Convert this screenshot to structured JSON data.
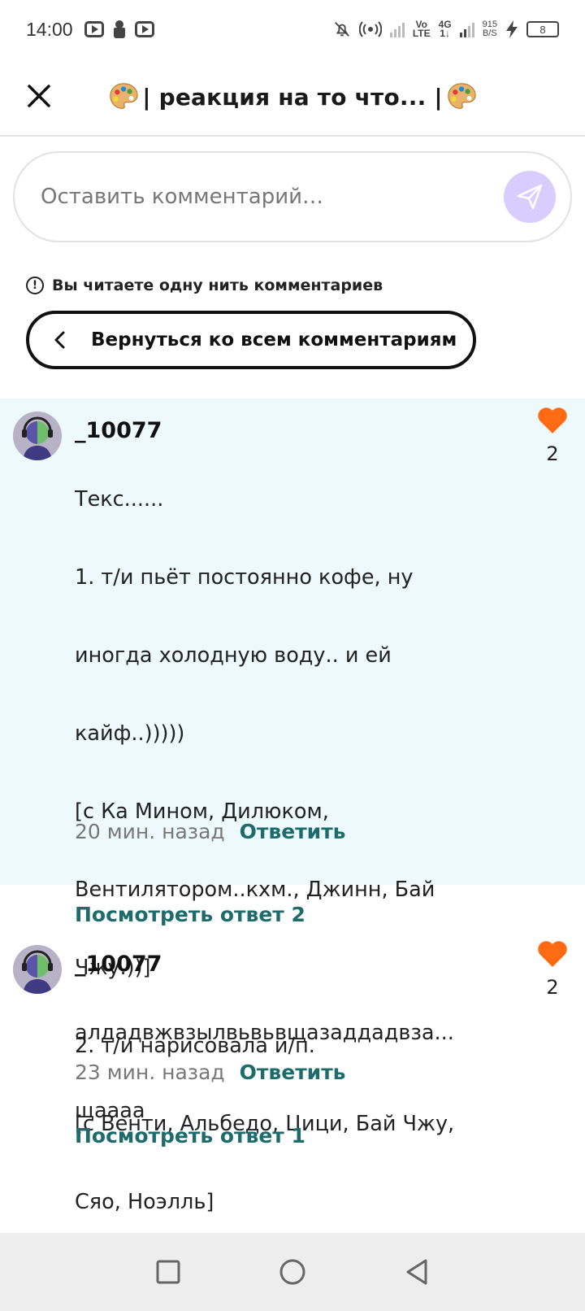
{
  "status_bar": {
    "time": "14:00",
    "net_top": "Vo",
    "net_bottom": "LTE",
    "net2_top": "4G",
    "net2_bottom": "1↓",
    "speed_value": "915",
    "speed_unit": "B/S",
    "battery": "8"
  },
  "header": {
    "title": "| реакция на то что... |"
  },
  "comment_box": {
    "placeholder": "Оставить комментарий…"
  },
  "thread": {
    "notice": "Вы читаете одну нить комментариев",
    "back_button": "Вернуться ко всем комментариям"
  },
  "comments": [
    {
      "author": "_10077",
      "lines": [
        "Текс......",
        "1. т/и пьёт постоянно кофе, ну",
        "иногда холодную воду.. и ей",
        "кайф..)))))",
        "[с Ка Мином, Дилюком,",
        "Вентилятором..кхм., Джинн, Бай",
        "Чжу.))]",
        "2. т/и нарисовала и/п.",
        "[с Венти, Альбедо, Цици, Бай Чжу,",
        "Сяо, Ноэлль]"
      ],
      "time": "20 мин. назад",
      "reply": "Ответить",
      "likes": "2",
      "view_replies": "Посмотреть ответ 2"
    },
    {
      "author": "_10077",
      "lines": [
        "алдадвжвзылвьвьвщазаддадвза...",
        "щаааа"
      ],
      "time": "23 мин. назад",
      "reply": "Ответить",
      "likes": "2",
      "view_replies": "Посмотреть ответ 1"
    }
  ],
  "colors": {
    "accent": "#1e6b6b",
    "heart": "#ff6a13",
    "highlight_bg": "#eef9fd",
    "send_bg": "#d9ccff"
  },
  "icons": {
    "close": "close-icon",
    "send": "send-icon",
    "info": "info-icon",
    "back": "chevron-left-icon",
    "heart": "heart-icon",
    "palette": "palette-icon"
  }
}
